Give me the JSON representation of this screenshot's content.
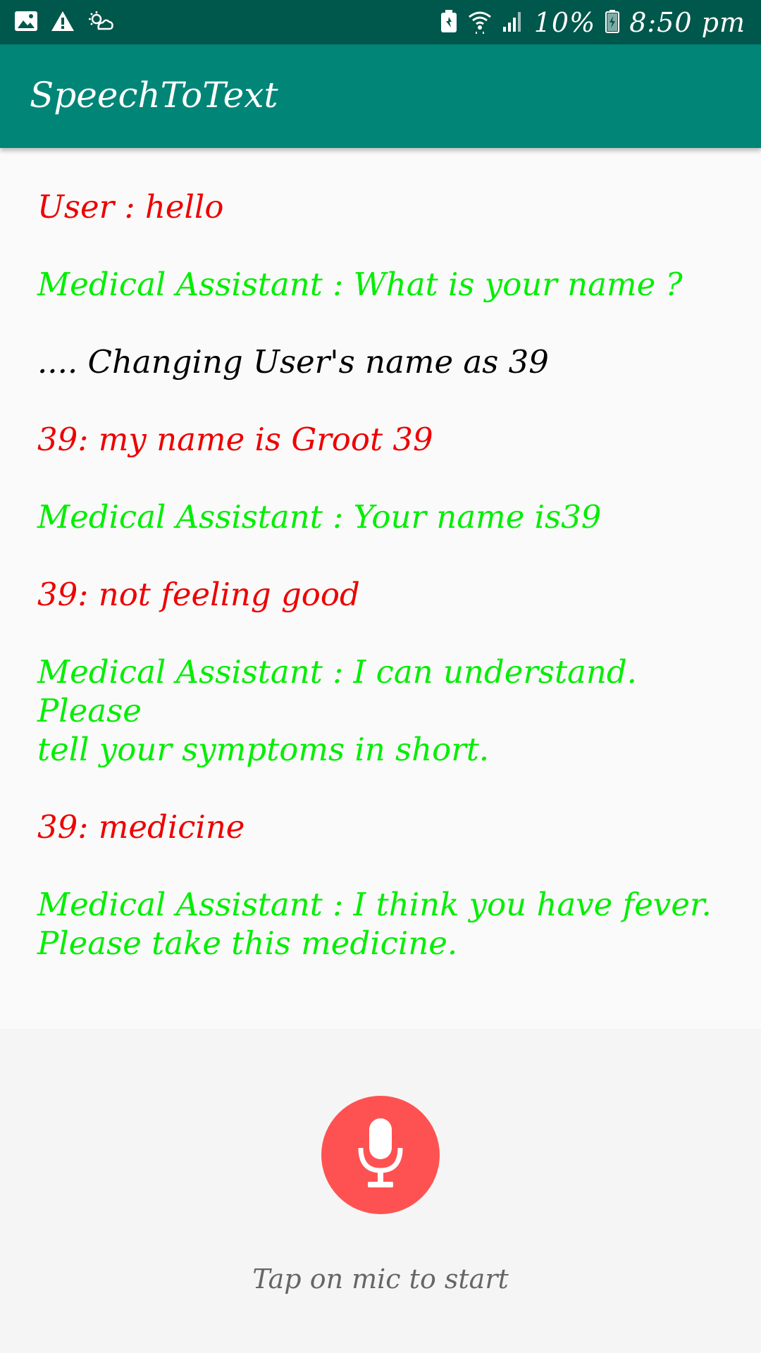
{
  "status_bar": {
    "battery_percent": "10%",
    "time": "8:50 pm",
    "icons": [
      "image-icon",
      "warning-icon",
      "weather-icon",
      "battery-saver-icon",
      "wifi-icon",
      "signal-icon",
      "battery-icon"
    ]
  },
  "app_bar": {
    "title": "SpeechToText"
  },
  "conversation": [
    {
      "text": "User : hello",
      "speaker": "user",
      "color": "#ee0000"
    },
    {
      "text": "Medical Assistant : What is your name ?",
      "speaker": "assistant",
      "color": "#00ee00"
    },
    {
      "text": ".... Changing User's name as 39",
      "speaker": "system",
      "color": "#000000"
    },
    {
      "text": "39: my name is Groot 39",
      "speaker": "user",
      "color": "#ee0000"
    },
    {
      "text": "Medical Assistant : Your name is39",
      "speaker": "assistant",
      "color": "#00ee00"
    },
    {
      "text": "39: not feeling good",
      "speaker": "user",
      "color": "#ee0000"
    },
    {
      "text": "Medical Assistant : I can understand. Please\ntell your symptoms in short.",
      "speaker": "assistant",
      "color": "#00ee00"
    },
    {
      "text": "39: medicine",
      "speaker": "user",
      "color": "#ee0000"
    },
    {
      "text": "Medical Assistant : I think you have fever.\nPlease take this medicine.",
      "speaker": "assistant",
      "color": "#00ee00"
    }
  ],
  "mic": {
    "icon": "microphone-icon",
    "color": "#fe5252",
    "hint": "Tap on mic to start"
  },
  "colors": {
    "status_bar": "#00574b",
    "app_bar": "#008577",
    "user_text": "#ee0000",
    "assistant_text": "#00ee00",
    "system_text": "#000000"
  }
}
